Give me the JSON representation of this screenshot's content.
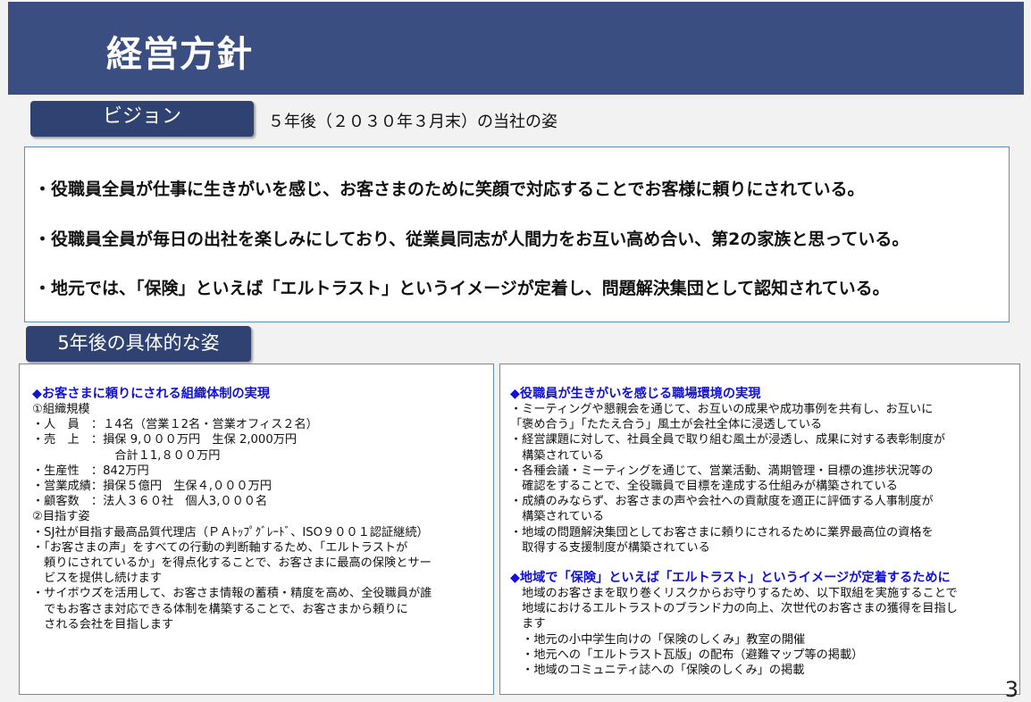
{
  "header": {
    "title": "経営方針"
  },
  "vision": {
    "tag": "ビジョン",
    "subtitle": "５年後（２０３０年３月末）の当社の姿",
    "lines": [
      "・役職員全員が仕事に生きがいを感じ、お客さまのために笑顔で対応することでお客様に頼りにされている。",
      "・役職員全員が毎日の出社を楽しみにしており、従業員同志が人間力をお互い高め合い、第2の家族と思っている。",
      "・地元では、「保険」といえば「エルトラスト」というイメージが定着し、問題解決集団として認知されている。"
    ]
  },
  "future": {
    "tag": "5年後の具体的な姿",
    "left": {
      "heading": "◆お客さまに頼りにされる組織体制の実現",
      "lines": [
        "①組織規模",
        "・人　員　：１4名（営業１2名・営業オフィス２名）",
        "・売　上　：損保 9,０００万円　生保 2,000万円",
        "　　　　　　　合計１1,８００万円",
        "・生産性　：842万円",
        "・営業成績：損保５億円　生保４,０００万円",
        "・顧客数　：法人３６０社　個人3,０００名",
        "②目指す姿",
        "・SJ社が目指す最高品質代理店（ＰＡﾄｯﾌﾟｸﾞﾚｰﾄﾞ、ISO９００１認証継続）",
        "・「お客さまの声」をすべての行動の判断軸するため、「エルトラストが",
        "　頼りにされているか」を得点化することで、お客さまに最高の保険とサー",
        "　ビスを提供し続けます",
        "・サイボウズを活用して、お客さま情報の蓄積・精度を高め、全役職員が誰",
        "　でもお客さま対応できる体制を構築することで、お客さまから頼りに",
        "　される会社を目指します"
      ]
    },
    "right": {
      "heading1": "◆役職員が生きがいを感じる職場環境の実現",
      "lines1": [
        "・ミーティングや懇親会を通じて、お互いの成果や成功事例を共有し、お互いに",
        "「褒め合う」「たたえ合う」風土が会社全体に浸透している",
        "・経営課題に対して、社員全員で取り組む風土が浸透し、成果に対する表彰制度が",
        "　構築されている",
        "・各種会議・ミーティングを通じて、営業活動、満期管理・目標の進捗状況等の",
        "　確認をすることで、全役職員で目標を達成する仕組みが構築されている",
        "・成績のみならず、お客さまの声や会社への貢献度を適正に評価する人事制度が",
        "　構築されている",
        "・地域の問題解決集団としてお客さまに頼りにされるために業界最高位の資格を",
        "　取得する支援制度が構築されている"
      ],
      "heading2": "◆地域で「保険」といえば「エルトラスト」というイメージが定着するために",
      "lines2": [
        "　地域のお客さまを取り巻くリスクからお守りするため、以下取組を実施することで",
        "　地域におけるエルトラストのブランド力の向上、次世代のお客さまの獲得を目指し",
        "　ます",
        "　・地元の小中学生向けの「保険のしくみ」教室の開催",
        "　・地元への「エルトラスト瓦版」の配布（避難マップ等の掲載）",
        "　・地域のコミュニティ誌への「保険のしくみ」の掲載"
      ]
    }
  },
  "page_number": "3"
}
